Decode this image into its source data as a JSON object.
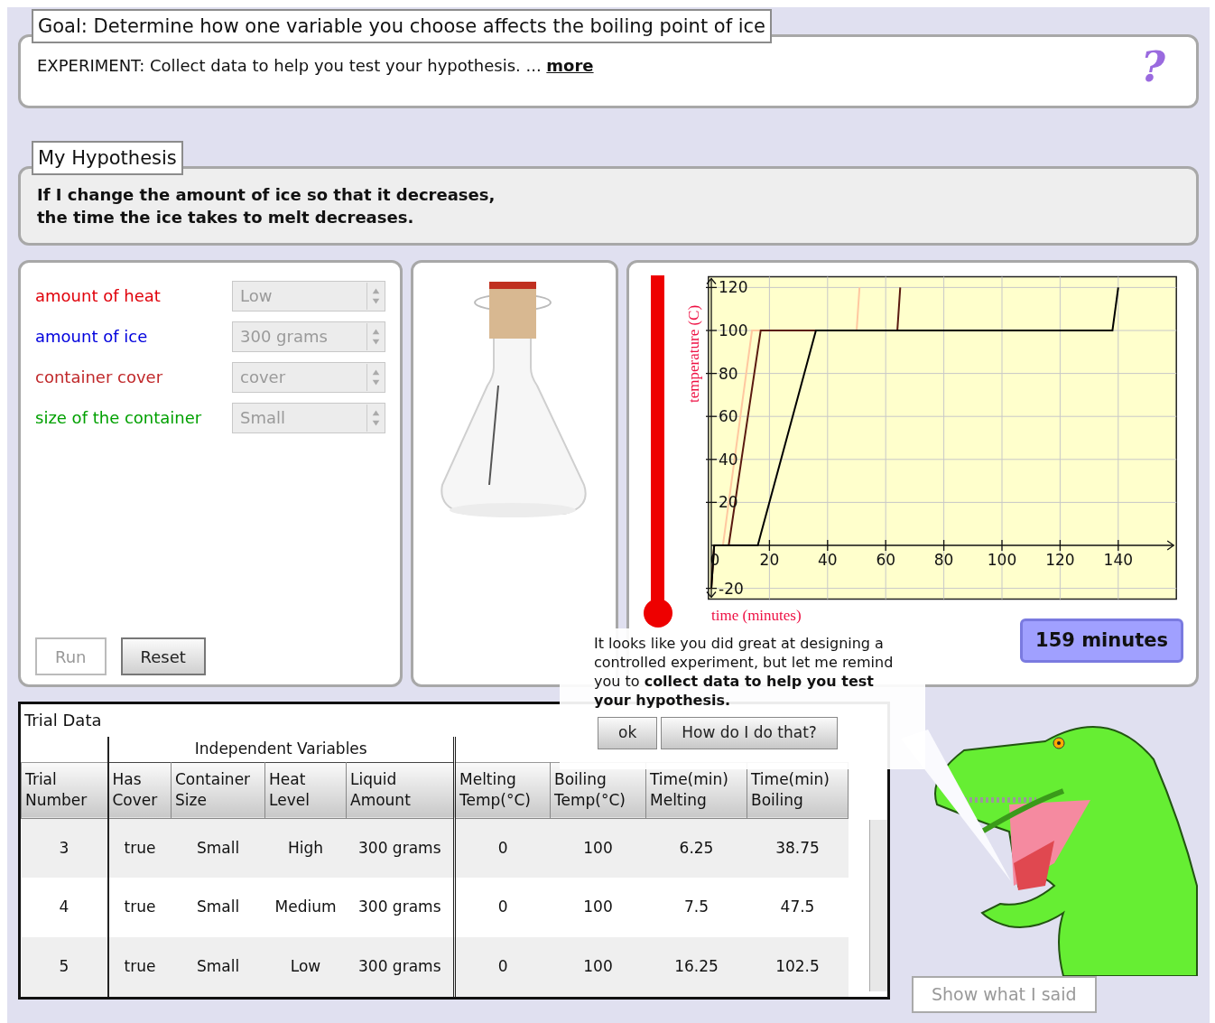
{
  "goal": {
    "title": "Goal: Determine how one variable you choose affects the boiling point of ice"
  },
  "instructions": {
    "text": "EXPERIMENT: Collect data to help you test your hypothesis. ...",
    "link": "more",
    "help": "?"
  },
  "hypothesis": {
    "title": "My Hypothesis",
    "lines": [
      "If I change the amount of ice so that it decreases,",
      "the time the ice takes to melt decreases."
    ]
  },
  "variables": [
    {
      "label": "amount of heat",
      "color": "#e0000a",
      "value": "Low",
      "disabled": true
    },
    {
      "label": "amount of ice",
      "color": "#0000dd",
      "value": "300 grams",
      "disabled": true
    },
    {
      "label": "container cover",
      "color": "#c0282a",
      "value": "cover",
      "disabled": true
    },
    {
      "label": "size of the container",
      "color": "#00a000",
      "value": "Small",
      "disabled": true
    }
  ],
  "controls": [
    {
      "label": "Run",
      "disabled": true
    },
    {
      "label": "Reset",
      "disabled": false
    }
  ],
  "thermometer": {
    "level": 1
  },
  "graph": {
    "chart_data": {
      "type": "line",
      "xlabel": "time (minutes)",
      "ylabel": "temperature (C)",
      "grid": true,
      "x": [
        0,
        1,
        4,
        6,
        14,
        16,
        17,
        36,
        50,
        51,
        64,
        65,
        138,
        140
      ],
      "xlim": [
        -1,
        160
      ],
      "ylim": [
        -25,
        125
      ],
      "xticks": [
        0,
        20,
        40,
        60,
        80,
        100,
        120,
        140
      ],
      "yticks": [
        -20,
        20,
        40,
        60,
        80,
        100,
        120
      ],
      "series": [
        {
          "color": "#ffc8a0",
          "values": [
            -20,
            0,
            0,
            20,
            100,
            100,
            100,
            100,
            100,
            120,
            null,
            null,
            null,
            null
          ]
        },
        {
          "color": "#5a1a10",
          "values": [
            -20,
            0,
            0,
            0,
            73,
            91,
            100,
            100,
            100,
            100,
            100,
            120,
            null,
            null
          ]
        },
        {
          "color": "#000000",
          "values": [
            -20,
            0,
            0,
            0,
            0,
            0,
            5,
            100,
            100,
            100,
            100,
            100,
            100,
            120
          ]
        }
      ]
    }
  },
  "elapsed": "159 minutes",
  "message": {
    "text": "It looks like you did great at designing a controlled experiment, but let me remind you to **collect data to help you test your hypothesis.**",
    "buttons": [
      "ok",
      "How do I do that?"
    ]
  },
  "trial_data": {
    "title": "Trial Data",
    "group": "Independent Variables",
    "columns": [
      {
        "label": "Trial\nNumber",
        "in_group": false
      },
      {
        "label": "Has\nCover",
        "in_group": true
      },
      {
        "label": "Container\nSize",
        "in_group": true
      },
      {
        "label": "Heat\nLevel",
        "in_group": true
      },
      {
        "label": "Liquid\nAmount",
        "in_group": true
      },
      {
        "label": "Melting\nTemp(°C)",
        "in_group": false
      },
      {
        "label": "Boiling\nTemp(°C)",
        "in_group": false
      },
      {
        "label": "Time(min)\nMelting",
        "in_group": false
      },
      {
        "label": "Time(min)\nBoiling",
        "in_group": false
      }
    ],
    "rows": [
      [
        "3",
        "true",
        "Small",
        "High",
        "300 grams",
        "0",
        "100",
        "6.25",
        "38.75"
      ],
      [
        "4",
        "true",
        "Small",
        "Medium",
        "300 grams",
        "0",
        "100",
        "7.5",
        "47.5"
      ],
      [
        "5",
        "true",
        "Small",
        "Low",
        "300 grams",
        "0",
        "100",
        "16.25",
        "102.5"
      ]
    ]
  },
  "show_said": "Show what I said"
}
